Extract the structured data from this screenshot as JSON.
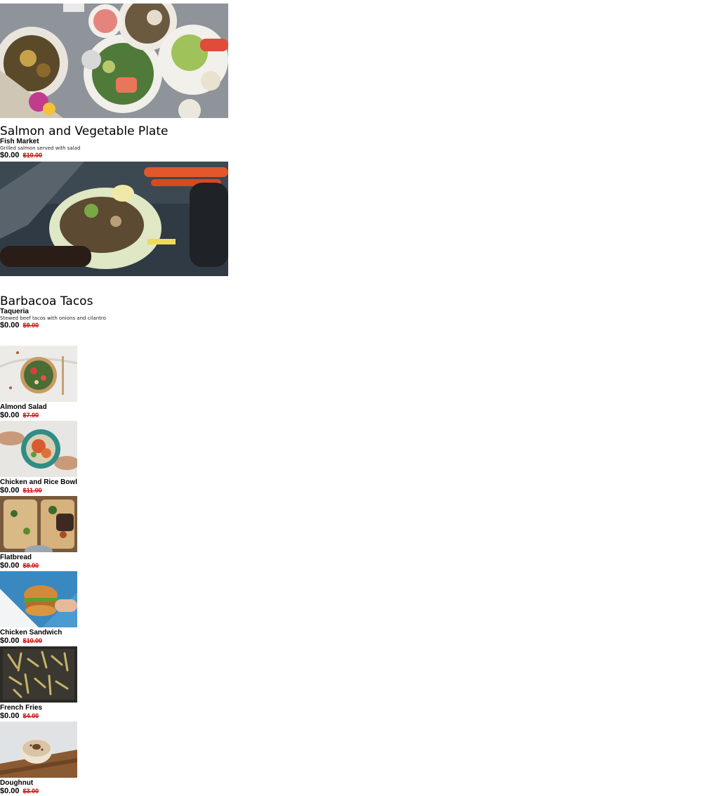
{
  "featured": [
    {
      "title": "Salmon and Vegetable Plate",
      "vendor": "Fish Market",
      "description": "Grilled salmon served with salad",
      "price": "$0.00",
      "original_price": "$10.00",
      "photo": "salmon-plate-photo"
    },
    {
      "title": "Barbacoa Tacos",
      "vendor": "Taqueria",
      "description": "Stewed beef tacos with onions and cilantro",
      "price": "$0.00",
      "original_price": "$9.00",
      "photo": "barbacoa-tacos-photo"
    }
  ],
  "items": [
    {
      "name": "Almond Salad",
      "price": "$0.00",
      "original_price": "$7.00",
      "photo": "almond-salad-photo"
    },
    {
      "name": "Chicken and Rice Bowl",
      "price": "$0.00",
      "original_price": "$11.00",
      "photo": "chicken-rice-bowl-photo"
    },
    {
      "name": "Flatbread",
      "price": "$0.00",
      "original_price": "$9.00",
      "photo": "flatbread-photo"
    },
    {
      "name": "Chicken Sandwich",
      "price": "$0.00",
      "original_price": "$10.00",
      "photo": "chicken-sandwich-photo"
    },
    {
      "name": "French Fries",
      "price": "$0.00",
      "original_price": "$4.00",
      "photo": "french-fries-photo"
    },
    {
      "name": "Doughnut",
      "price": "$0.00",
      "original_price": "$3.00",
      "photo": "doughnut-photo"
    }
  ]
}
